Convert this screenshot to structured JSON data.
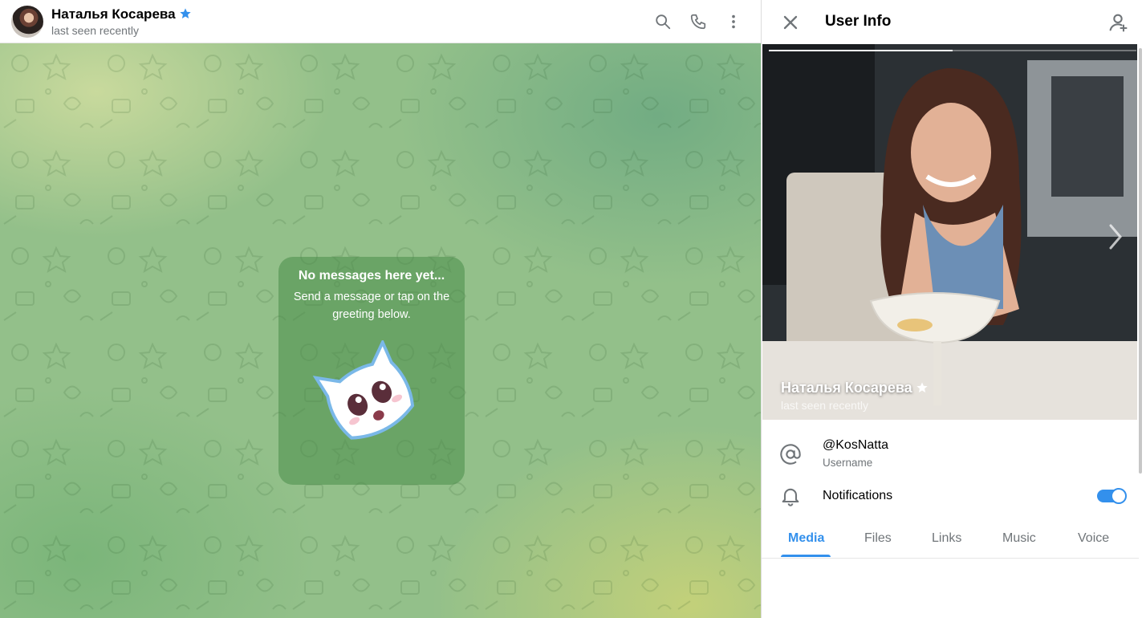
{
  "chat": {
    "title": "Наталья Косарева",
    "status": "last seen recently",
    "empty": {
      "title": "No messages here yet...",
      "subtitle": "Send a message or tap on the greeting below."
    }
  },
  "header_icons": [
    "search-icon",
    "phone-icon",
    "more-vertical-icon"
  ],
  "panel": {
    "title": "User Info",
    "profile_name": "Наталья Косарева",
    "profile_status": "last seen recently",
    "photo_progress": 0.5,
    "username": "@KosNatta",
    "username_label": "Username",
    "notifications_label": "Notifications",
    "notifications_on": true,
    "tabs": [
      {
        "label": "Media",
        "active": true
      },
      {
        "label": "Files",
        "active": false
      },
      {
        "label": "Links",
        "active": false
      },
      {
        "label": "Music",
        "active": false
      },
      {
        "label": "Voice",
        "active": false
      }
    ]
  },
  "colors": {
    "accent": "#3390ec",
    "secondary_text": "#707579"
  }
}
